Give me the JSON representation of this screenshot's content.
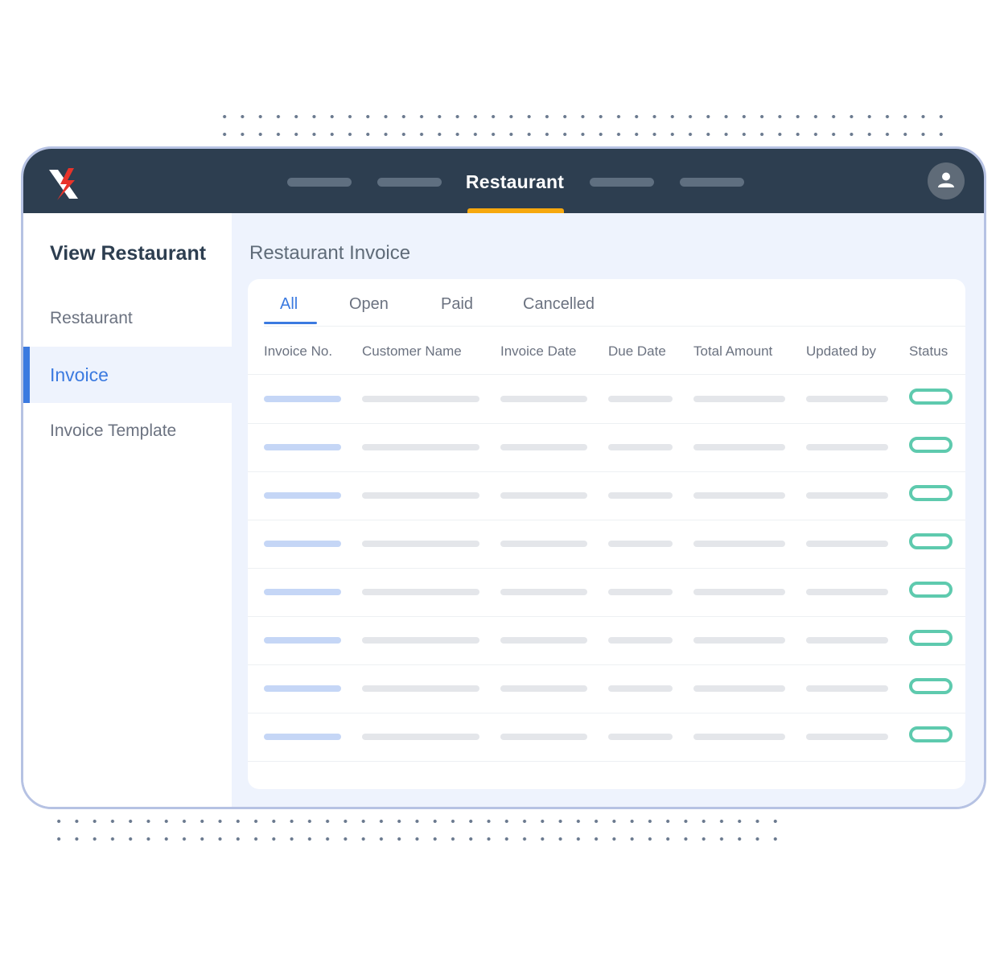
{
  "header": {
    "active_nav": "Restaurant",
    "accent_color": "#f6a80f",
    "background_color": "#2d3e50",
    "logo_icon": "x-bolt-logo-icon",
    "avatar_icon": "user-icon"
  },
  "sidebar": {
    "title": "View Restaurant",
    "items": [
      {
        "label": "Restaurant",
        "active": false
      },
      {
        "label": "Invoice",
        "active": true
      },
      {
        "label": "Invoice Template",
        "active": false
      }
    ]
  },
  "main": {
    "title": "Restaurant Invoice",
    "tabs": [
      {
        "label": "All",
        "active": true
      },
      {
        "label": "Open",
        "active": false
      },
      {
        "label": "Paid",
        "active": false
      },
      {
        "label": "Cancelled",
        "active": false
      }
    ],
    "columns": [
      "Invoice No.",
      "Customer Name",
      "Invoice Date",
      "Due Date",
      "Total Amount",
      "Updated by",
      "Status"
    ],
    "row_count": 8,
    "status_color": "#5ecaae",
    "link_color": "#3b7ae0"
  }
}
